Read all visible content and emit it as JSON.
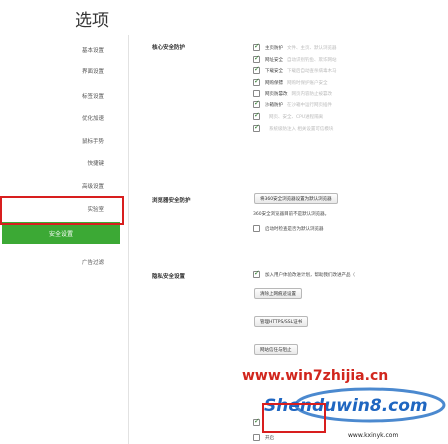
{
  "window": {
    "title": "选项"
  },
  "sidebar": {
    "items": [
      {
        "label": "基本设置"
      },
      {
        "label": "界面设置"
      },
      {
        "label": "标签设置"
      },
      {
        "label": "优化加速"
      },
      {
        "label": "鼠标手势"
      },
      {
        "label": "快捷键"
      },
      {
        "label": "高级设置"
      },
      {
        "label": "实验室"
      },
      {
        "label": "安全设置",
        "active": true
      },
      {
        "label": "广告过滤"
      }
    ]
  },
  "sections": {
    "core": {
      "title": "核心安全防护",
      "items": [
        {
          "label": "主页防护",
          "desc": "文件、主页、默认浏览器",
          "checked": true
        },
        {
          "label": "网址安全",
          "desc": "自动识别钓鱼、欺诈网站",
          "checked": true
        },
        {
          "label": "下载安全",
          "desc": "下载后自动查杀病毒木马",
          "checked": true
        },
        {
          "label": "网购保镖",
          "desc": "网购时保护账户安全",
          "checked": true
        },
        {
          "label": "网页防篡改",
          "desc": "网页内容防止被篡改",
          "checked": false
        },
        {
          "label": "沙箱防护",
          "desc": "在沙箱中运行网页插件",
          "checked": true
        },
        {
          "label": "",
          "desc": "网页、安全、CPU进程隔离",
          "checked": true
        },
        {
          "label": "",
          "desc": "系统级防注入 相关设置可信模块",
          "checked": true
        }
      ]
    },
    "browser": {
      "title": "浏览器安全防护",
      "button": "将360安全浏览器设置为默认浏览器",
      "note": "360安全浏览器目前不是默认浏览器。",
      "check": {
        "label": "启动时检查是否为默认浏览器",
        "checked": false
      }
    },
    "privacy": {
      "title": "隐私安全设置",
      "check": {
        "label": "加入用户体验改进计划，帮助我们改进产品（",
        "checked": true
      },
      "buttons": [
        "清除上网痕迹设置",
        "管理HTTPS/SSL证书",
        "网站信任与阻止"
      ],
      "extra": [
        {
          "label": "",
          "checked": true
        },
        {
          "label": "开启",
          "checked": false
        }
      ]
    }
  },
  "watermarks": {
    "top": "www.win7zhijia.cn",
    "logo": "Shenduwin8.com",
    "bottom": "www.kxinyk.com"
  },
  "colors": {
    "accent": "#3ca935",
    "highlight": "#d81e1e"
  }
}
